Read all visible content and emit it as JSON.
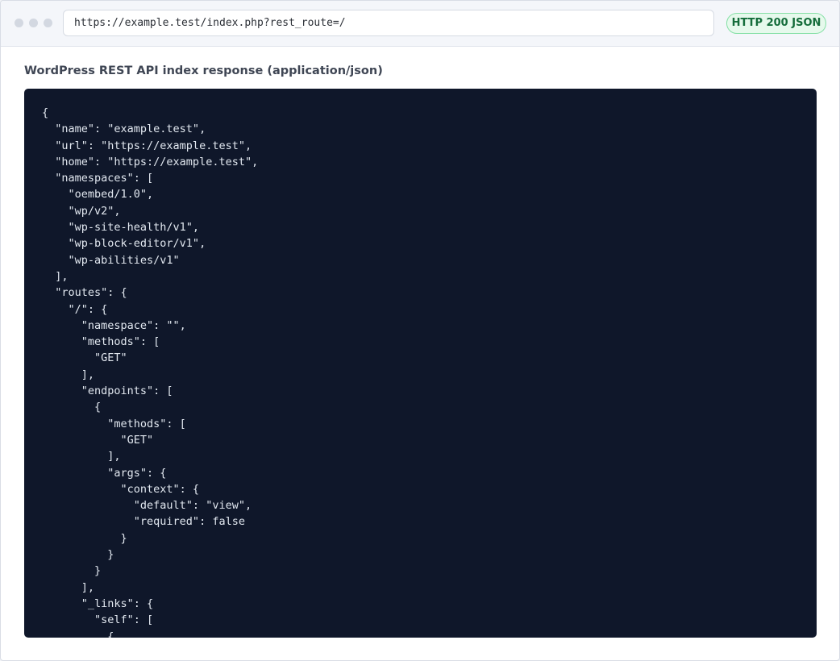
{
  "browser": {
    "url": "https://example.test/index.php?rest_route=/",
    "status_badge": "HTTP 200 JSON"
  },
  "content": {
    "heading": "WordPress REST API index response (application/json)",
    "response_body": "{\n  \"name\": \"example.test\",\n  \"url\": \"https://example.test\",\n  \"home\": \"https://example.test\",\n  \"namespaces\": [\n    \"oembed/1.0\",\n    \"wp/v2\",\n    \"wp-site-health/v1\",\n    \"wp-block-editor/v1\",\n    \"wp-abilities/v1\"\n  ],\n  \"routes\": {\n    \"/\": {\n      \"namespace\": \"\",\n      \"methods\": [\n        \"GET\"\n      ],\n      \"endpoints\": [\n        {\n          \"methods\": [\n            \"GET\"\n          ],\n          \"args\": {\n            \"context\": {\n              \"default\": \"view\",\n              \"required\": false\n            }\n          }\n        }\n      ],\n      \"_links\": {\n        \"self\": [\n          {"
  },
  "colors": {
    "code_background": "#0f172a",
    "code_text": "#e2e8f0",
    "badge_background": "#e6f9ec",
    "badge_border": "#86e0a6",
    "badge_text": "#146c3a"
  }
}
